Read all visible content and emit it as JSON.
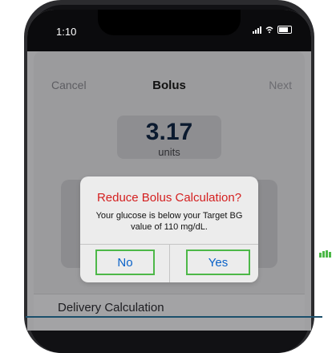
{
  "status_bar": {
    "time": "1:10"
  },
  "nav": {
    "cancel": "Cancel",
    "title": "Bolus",
    "next": "Next"
  },
  "bolus": {
    "value": "3.17",
    "unit_label": "units"
  },
  "dialog": {
    "title": "Reduce Bolus Calculation?",
    "message": "Your glucose is below your Target BG value of 110 mg/dL.",
    "no_label": "No",
    "yes_label": "Yes"
  },
  "section": {
    "delivery_label": "Delivery Calculation"
  },
  "colors": {
    "dialog_title": "#d41f1f",
    "button_text": "#0a62c9",
    "highlight_border": "#4db848",
    "accent_line": "#1b4f6b"
  }
}
